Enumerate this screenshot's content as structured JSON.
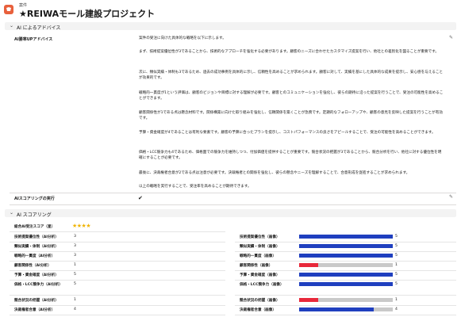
{
  "header": {
    "object_label": "案件",
    "title": "★REIWAモール建設プロジェクト"
  },
  "advice_section": {
    "title": "AI によるアドバイス",
    "field_label": "AI勝率UPアドバイス",
    "paragraphs": [
      "案件の受注に向けた具体的な戦略を以下に示します。",
      "まず、技術提案優位性が3であることから、技術的なアプローチを強化する必要があります。顧客のニーズに合わせたカスタマイズ提案を行い、他社との差別化を図ることが重要です。",
      "次に、類似実績・体制も3であるため、過去の成功事例を具体的に示し、信頼性を高めることが求められます。顧客に対して、実績を基にした具体的な成果を提示し、安心感を与えることが効果的です。",
      "戦略的一貫度が1という評価は、顧客のビジョンや目標に対する理解が必要です。顧客とのコミュニケーションを強化し、彼らの期待に沿った提案を行うことで、受注の可能性を高めることができます。",
      "顧客関係性が1である点は懸念材料です。関係構築に向けた取り組みを強化し、信頼関係を築くことが急務です。定期的なフォローアップや、顧客の意見を反映した提案を行うことが有効です。",
      "予算・資金確度が4であることは有利な要素です。顧客の予算に合ったプランを提示し、コストパフォーマンスの良さをアピールすることで、受注の可能性を高めることができます。",
      "価格・LCC競争力も4であるため、価格面での競争力を維持しつつ、付加価値を提供することが重要です。競合状況の把握が3であることから、競合分析を行い、他社に対する優位性を明確にすることが必要です。",
      "最後に、決裁権者合意が2である点は注意が必要です。決裁権者との関係を強化し、彼らの懸念やニーズを理解することで、合意形成を促進することが求められます。",
      "以上の戦略を実行することで、受注率を高めることが期待できます。"
    ],
    "execute_label": "AIスコアリングの実行"
  },
  "scoring_section": {
    "title": "AI スコアリング",
    "overall_label": "総合AI受注スコア（星）",
    "overall_stars": 4,
    "left_rows": [
      {
        "label": "技術提案優位性（AI分析）",
        "value": "3"
      },
      {
        "label": "類似実績・体制（AI分析）",
        "value": "3"
      },
      {
        "label": "戦略的一貫度（AI分析）",
        "value": "3"
      },
      {
        "label": "顧客関係性（AI分析）",
        "value": "1"
      },
      {
        "label": "予算・資金確度（AI分析）",
        "value": "5"
      },
      {
        "label": "価格・LCC競争力（AI分析）",
        "value": "5"
      },
      {
        "label": "競合状況の把握（AI分析）",
        "value": "1"
      },
      {
        "label": "決裁権者合意（AI分析）",
        "value": "4"
      }
    ],
    "right_rows": [
      {
        "label": "技術提案優位性（画像）",
        "value": "5",
        "fraction": 1.0,
        "color": "#1f3fbf"
      },
      {
        "label": "類似実績・体制（画像）",
        "value": "5",
        "fraction": 1.0,
        "color": "#1f3fbf"
      },
      {
        "label": "戦略的一貫度（画像）",
        "value": "5",
        "fraction": 1.0,
        "color": "#1f3fbf"
      },
      {
        "label": "顧客関係性（画像）",
        "value": "1",
        "fraction": 0.2,
        "color": "#e8283a"
      },
      {
        "label": "予算・資金確度（画像）",
        "value": "5",
        "fraction": 1.0,
        "color": "#1f3fbf"
      },
      {
        "label": "価格・LCC競争力（画像）",
        "value": "5",
        "fraction": 1.0,
        "color": "#1f3fbf"
      },
      {
        "label": "競合状況の把握（画像）",
        "value": "1",
        "fraction": 0.2,
        "color": "#e8283a"
      },
      {
        "label": "決裁権者合意（画像）",
        "value": "4",
        "fraction": 0.8,
        "color": "#1f3fbf"
      }
    ]
  }
}
